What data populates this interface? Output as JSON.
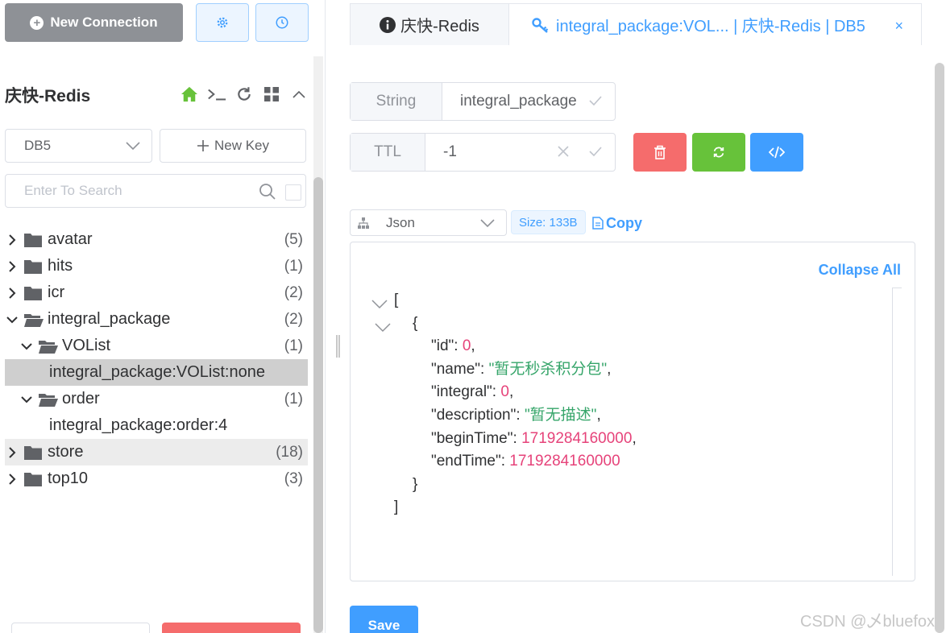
{
  "toolbar": {
    "new_connection_label": "New Connection"
  },
  "connection": {
    "title": "庆快-Redis",
    "db_selected": "DB5",
    "new_key_label": "New Key",
    "search_placeholder": "Enter To Search"
  },
  "tree": [
    {
      "label": "avatar",
      "count": "(5)",
      "type": "folder",
      "open": false,
      "depth": 0
    },
    {
      "label": "hits",
      "count": "(1)",
      "type": "folder",
      "open": false,
      "depth": 0
    },
    {
      "label": "icr",
      "count": "(2)",
      "type": "folder",
      "open": false,
      "depth": 0
    },
    {
      "label": "integral_package",
      "count": "(2)",
      "type": "folder",
      "open": true,
      "depth": 0
    },
    {
      "label": "VOList",
      "count": "(1)",
      "type": "folder",
      "open": true,
      "depth": 1
    },
    {
      "label": "integral_package:VOList:none",
      "count": "",
      "type": "key",
      "state": "selected",
      "depth": 2
    },
    {
      "label": "order",
      "count": "(1)",
      "type": "folder",
      "open": true,
      "depth": 1
    },
    {
      "label": "integral_package:order:4",
      "count": "",
      "type": "key",
      "depth": 2
    },
    {
      "label": "store",
      "count": "(18)",
      "type": "folder",
      "open": false,
      "state": "hover",
      "depth": 0
    },
    {
      "label": "top10",
      "count": "(3)",
      "type": "folder",
      "open": false,
      "depth": 0
    }
  ],
  "tabs": {
    "info_tab": "庆快-Redis",
    "key_tab": "integral_package:VOL... | 庆快-Redis | DB5"
  },
  "key": {
    "type": "String",
    "name": "integral_package",
    "ttl_label": "TTL",
    "ttl": "-1",
    "format": "Json",
    "size": "Size: 133B",
    "copy_label": "Copy",
    "collapse_all_label": "Collapse All",
    "save_label": "Save"
  },
  "json_lines": [
    {
      "indent": 0,
      "fold": true,
      "parts": [
        {
          "t": "[",
          "c": "k"
        }
      ]
    },
    {
      "indent": 1,
      "fold": true,
      "parts": [
        {
          "t": "{",
          "c": "k"
        }
      ]
    },
    {
      "indent": 2,
      "fold": false,
      "parts": [
        {
          "t": "\"id\": ",
          "c": "k"
        },
        {
          "t": "0",
          "c": "n"
        },
        {
          "t": ",",
          "c": "k"
        }
      ]
    },
    {
      "indent": 2,
      "fold": false,
      "parts": [
        {
          "t": "\"name\": ",
          "c": "k"
        },
        {
          "t": "\"暂无秒杀积分包\"",
          "c": "s"
        },
        {
          "t": ",",
          "c": "k"
        }
      ]
    },
    {
      "indent": 2,
      "fold": false,
      "parts": [
        {
          "t": "\"integral\": ",
          "c": "k"
        },
        {
          "t": "0",
          "c": "n"
        },
        {
          "t": ",",
          "c": "k"
        }
      ]
    },
    {
      "indent": 2,
      "fold": false,
      "parts": [
        {
          "t": "\"description\": ",
          "c": "k"
        },
        {
          "t": "\"暂无描述\"",
          "c": "s"
        },
        {
          "t": ",",
          "c": "k"
        }
      ]
    },
    {
      "indent": 2,
      "fold": false,
      "parts": [
        {
          "t": "\"beginTime\": ",
          "c": "k"
        },
        {
          "t": "1719284160000",
          "c": "n"
        },
        {
          "t": ",",
          "c": "k"
        }
      ]
    },
    {
      "indent": 2,
      "fold": false,
      "parts": [
        {
          "t": "\"endTime\": ",
          "c": "k"
        },
        {
          "t": "1719284160000",
          "c": "n"
        }
      ]
    },
    {
      "indent": 1,
      "fold": false,
      "parts": [
        {
          "t": "}",
          "c": "k"
        }
      ]
    },
    {
      "indent": 0,
      "fold": false,
      "parts": [
        {
          "t": "]",
          "c": "k"
        }
      ]
    }
  ],
  "watermark": "CSDN @乄bluefox",
  "icons": {
    "home": "home-icon",
    "terminal": "terminal-icon",
    "refresh": "refresh-icon",
    "grid": "grid-icon",
    "collapse": "chevron-up-icon"
  },
  "colors": {
    "primary": "#409eff",
    "danger": "#f56c6c",
    "success": "#67c23a",
    "home_green": "#67c23a",
    "json_number": "#e6437a",
    "json_string": "#36a56a"
  }
}
